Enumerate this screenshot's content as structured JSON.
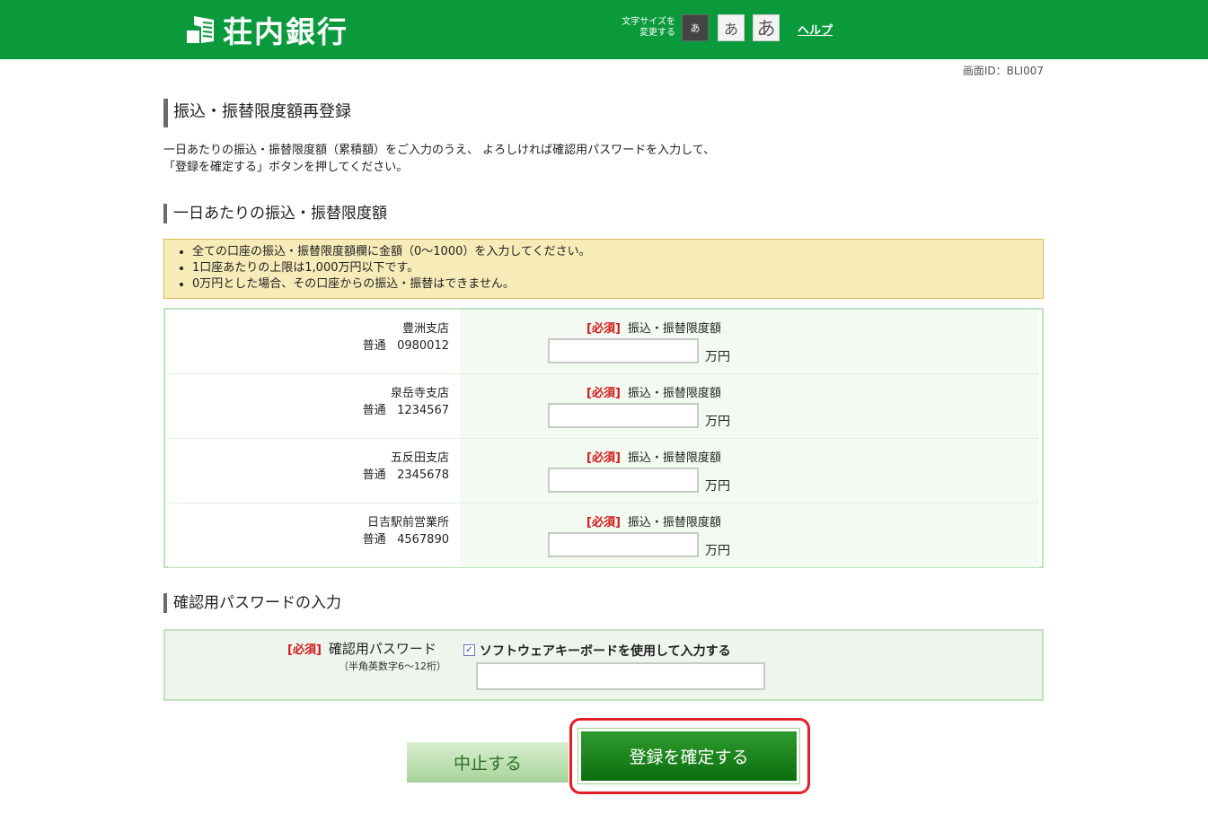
{
  "header": {
    "bank_name": "荘内銀行",
    "font_size_label_1": "文字サイズを",
    "font_size_label_2": "変更する",
    "font_small": "あ",
    "font_medium": "あ",
    "font_large": "あ",
    "help": "ヘルプ"
  },
  "screen_id": "画面ID：BLI007",
  "page_title": "振込・振替限度額再登録",
  "intro": {
    "line1": "一日あたりの振込・振替限度額（累積額）をご入力のうえ、 よろしければ確認用パスワードを入力して、",
    "line2": "「登録を確定する」ボタンを押してください。"
  },
  "limit_section": {
    "heading": "一日あたりの振込・振替限度額",
    "notes": [
      "全ての口座の振込・振替限度額欄に金額（0～1000）を入力してください。",
      "1口座あたりの上限は1,000万円以下です。",
      "0万円とした場合、その口座からの振込・振替はできません。"
    ],
    "required_label": "[必須]",
    "field_label": "振込・振替限度額",
    "unit": "万円",
    "accounts": [
      {
        "branch": "豊洲支店",
        "type": "普通",
        "number": "0980012",
        "value": ""
      },
      {
        "branch": "泉岳寺支店",
        "type": "普通",
        "number": "1234567",
        "value": ""
      },
      {
        "branch": "五反田支店",
        "type": "普通",
        "number": "2345678",
        "value": ""
      },
      {
        "branch": "日吉駅前営業所",
        "type": "普通",
        "number": "4567890",
        "value": ""
      }
    ]
  },
  "password_section": {
    "heading": "確認用パスワードの入力",
    "required_label": "[必須]",
    "label": "確認用パスワード",
    "note": "（半角英数字6～12桁）",
    "checkbox_label": "ソフトウェアキーボードを使用して入力する",
    "checkbox_checked": true,
    "value": ""
  },
  "buttons": {
    "cancel": "中止する",
    "confirm": "登録を確定する"
  },
  "colors": {
    "header_green": "#0a9a3c",
    "required_red": "#d01818",
    "highlight_red": "#e41e26"
  }
}
